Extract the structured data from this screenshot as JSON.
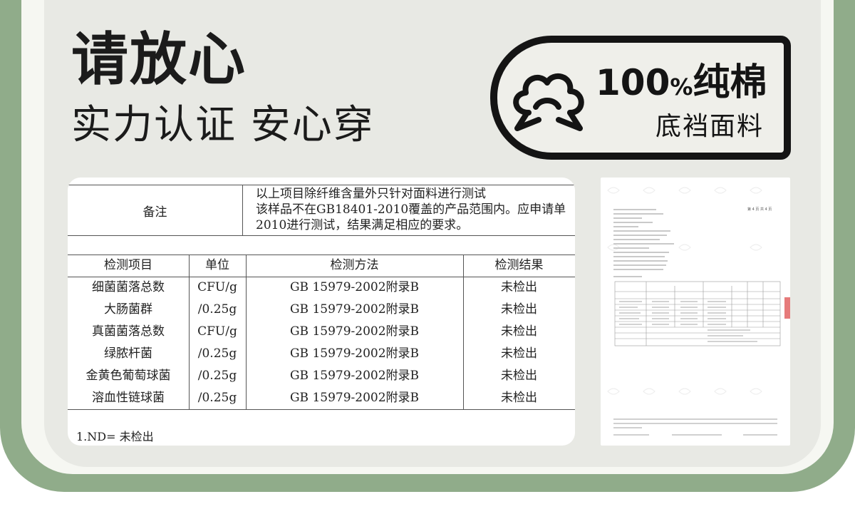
{
  "headline": "请放心",
  "subline": "实力认证 安心穿",
  "badge": {
    "number": "100",
    "percent": "%",
    "word": "纯棉",
    "caption": "底裆面料",
    "icon": "cotton-icon"
  },
  "remarks": {
    "label": "备注",
    "lines": [
      "以上项目除纤维含量外只针对面料进行测试",
      "该样品不在GB18401-2010覆盖的产品范围内。应申请单",
      "2010进行测试，结果满足相应的要求。"
    ]
  },
  "results": {
    "headers": [
      "检测项目",
      "单位",
      "检测方法",
      "检测结果"
    ],
    "rows": [
      [
        "细菌菌落总数",
        "CFU/g",
        "GB 15979-2002附录B",
        "未检出"
      ],
      [
        "大肠菌群",
        "/0.25g",
        "GB 15979-2002附录B",
        "未检出"
      ],
      [
        "真菌菌落总数",
        "CFU/g",
        "GB 15979-2002附录B",
        "未检出"
      ],
      [
        "绿脓杆菌",
        "/0.25g",
        "GB 15979-2002附录B",
        "未检出"
      ],
      [
        "金黄色葡萄球菌",
        "/0.25g",
        "GB 15979-2002附录B",
        "未检出"
      ],
      [
        "溶血性链球菌",
        "/0.25g",
        "GB 15979-2002附录B",
        "未检出"
      ]
    ],
    "footnote": "1.ND= 未检出"
  },
  "report_page": {
    "page_label": "第 4 页 共 4 页"
  }
}
